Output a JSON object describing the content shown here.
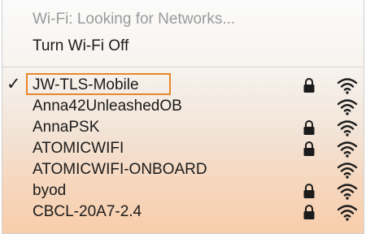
{
  "menu": {
    "status_label": "Wi-Fi: Looking for Networks...",
    "toggle_label": "Turn Wi-Fi Off"
  },
  "networks": [
    {
      "name": "JW-TLS-Mobile",
      "secured": true,
      "connected": true
    },
    {
      "name": "Anna42UnleashedOB",
      "secured": false,
      "connected": false
    },
    {
      "name": "AnnaPSK",
      "secured": true,
      "connected": false
    },
    {
      "name": "ATOMICWIFI",
      "secured": true,
      "connected": false
    },
    {
      "name": "ATOMICWIFI-ONBOARD",
      "secured": false,
      "connected": false
    },
    {
      "name": "byod",
      "secured": true,
      "connected": false
    },
    {
      "name": "CBCL-20A7-2.4",
      "secured": true,
      "connected": false
    }
  ],
  "icons": {
    "checkmark": "checkmark-icon",
    "lock": "lock-icon",
    "wifi": "wifi-signal-icon"
  },
  "colors": {
    "highlight_border": "#e8882a",
    "text": "#1b1b1b",
    "disabled_text": "#9a9a9a"
  },
  "checkmark_glyph": "✓"
}
